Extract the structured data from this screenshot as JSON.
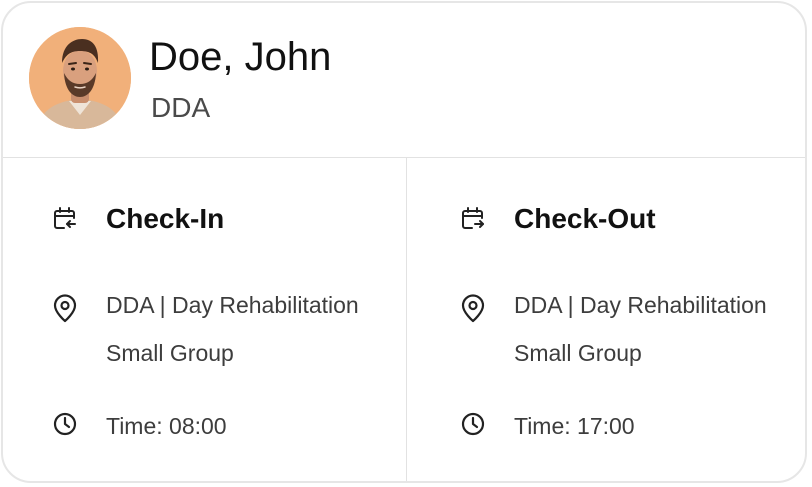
{
  "person": {
    "name": "Doe, John",
    "program": "DDA",
    "avatar_icon": "profile-photo"
  },
  "check_in": {
    "title": "Check-In",
    "icon": "calendar-arrow-in-icon",
    "location_line1": "DDA | Day Rehabilitation",
    "location_line2": "Small Group",
    "location_icon": "map-pin-icon",
    "time": "Time: 08:00",
    "time_icon": "clock-icon"
  },
  "check_out": {
    "title": "Check-Out",
    "icon": "calendar-arrow-out-icon",
    "location_line1": "DDA | Day Rehabilitation",
    "location_line2": "Small Group",
    "location_icon": "map-pin-icon",
    "time": "Time: 17:00",
    "time_icon": "clock-icon"
  },
  "colors": {
    "border": "#e6e6e6",
    "text_primary": "#111111",
    "text_secondary": "#3d3d3d",
    "avatar_background": "#f0b27a"
  }
}
